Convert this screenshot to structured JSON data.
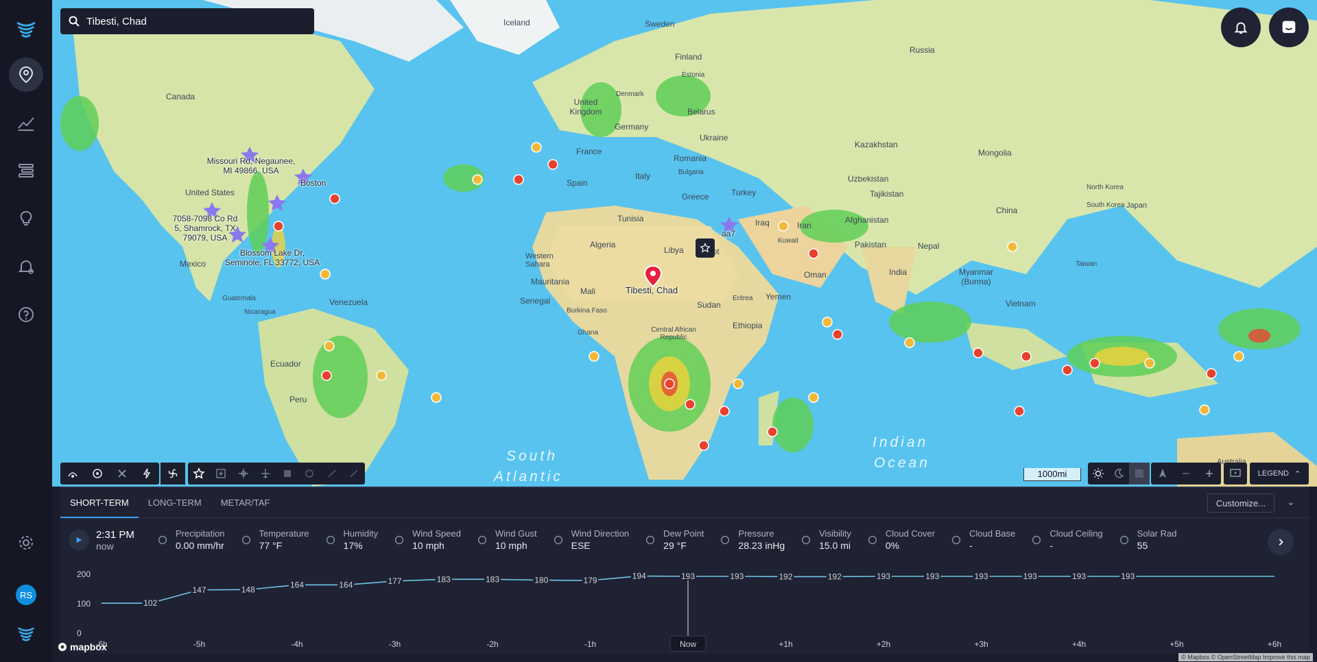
{
  "search": {
    "value": "Tibesti, Chad"
  },
  "map_labels": {
    "land": [
      {
        "text": "Iceland"
      },
      {
        "text": "Sweden"
      },
      {
        "text": "Finland"
      },
      {
        "text": "Russia"
      },
      {
        "text": "Estonia"
      },
      {
        "text": "Denmark"
      },
      {
        "text": "United Kingdom"
      },
      {
        "text": "Belarus"
      },
      {
        "text": "Germany"
      },
      {
        "text": "Ukraine"
      },
      {
        "text": "France"
      },
      {
        "text": "Romania"
      },
      {
        "text": "Bulgaria"
      },
      {
        "text": "Spain"
      },
      {
        "text": "Italy"
      },
      {
        "text": "Greece"
      },
      {
        "text": "Turkey"
      },
      {
        "text": "Kazakhstan"
      },
      {
        "text": "Mongolia"
      },
      {
        "text": "Uzbekistan"
      },
      {
        "text": "Tajikistan"
      },
      {
        "text": "Afghanistan"
      },
      {
        "text": "North Korea"
      },
      {
        "text": "South Korea"
      },
      {
        "text": "Japan"
      },
      {
        "text": "China"
      },
      {
        "text": "Iraq"
      },
      {
        "text": "Iran"
      },
      {
        "text": "Kuwait"
      },
      {
        "text": "Pakistan"
      },
      {
        "text": "Nepal"
      },
      {
        "text": "India"
      },
      {
        "text": "Oman"
      },
      {
        "text": "Yemen"
      },
      {
        "text": "Myanmar (Burma)"
      },
      {
        "text": "Taiwan"
      },
      {
        "text": "Vietnam"
      },
      {
        "text": "Tunisia"
      },
      {
        "text": "Algeria"
      },
      {
        "text": "Libya"
      },
      {
        "text": "Egypt"
      },
      {
        "text": "Western Sahara"
      },
      {
        "text": "Mauritania"
      },
      {
        "text": "Mali"
      },
      {
        "text": "Senegal"
      },
      {
        "text": "Burkina Faso"
      },
      {
        "text": "Sudan"
      },
      {
        "text": "Eritrea"
      },
      {
        "text": "Ethiopia"
      },
      {
        "text": "Ghana"
      },
      {
        "text": "Central African Republic"
      },
      {
        "text": "Canada"
      },
      {
        "text": "United States"
      },
      {
        "text": "Mexico"
      },
      {
        "text": "Guatemala"
      },
      {
        "text": "Nicaragua"
      },
      {
        "text": "Venezuela"
      },
      {
        "text": "Ecuador"
      },
      {
        "text": "Peru"
      },
      {
        "text": "Boston"
      },
      {
        "text": "Australia"
      }
    ],
    "seas": [
      {
        "text": "South"
      },
      {
        "text": "Atlantic"
      },
      {
        "text": "Indian"
      },
      {
        "text": "Ocean"
      }
    ],
    "saved": [
      {
        "text": "Missouri Rd, Negaunee, MI 49866, USA"
      },
      {
        "text": "7058-7098 Co Rd 5, Shamrock, TX 79079, USA"
      },
      {
        "text": "Blossom Lake Dr, Seminole, FL 33772, USA"
      },
      {
        "text": "aa7"
      }
    ]
  },
  "pin": {
    "label": "Tibesti, Chad"
  },
  "scale_label": "1000mi",
  "legend_label": "LEGEND",
  "tabs": [
    {
      "label": "SHORT-TERM"
    },
    {
      "label": "LONG-TERM"
    },
    {
      "label": "METAR/TAF"
    }
  ],
  "customize_label": "Customize...",
  "current": {
    "time": "2:31 PM",
    "sub": "now"
  },
  "metrics": [
    {
      "label": "Precipitation",
      "value": "0.00 mm/hr",
      "icon": "precipitation-icon"
    },
    {
      "label": "Temperature",
      "value": "77 °F",
      "icon": "thermometer-icon"
    },
    {
      "label": "Humidity",
      "value": "17%",
      "icon": "humidity-icon"
    },
    {
      "label": "Wind Speed",
      "value": "10 mph",
      "icon": "wind-icon"
    },
    {
      "label": "Wind Gust",
      "value": "10 mph",
      "icon": "wind-gust-icon"
    },
    {
      "label": "Wind Direction",
      "value": "ESE",
      "icon": "wind-direction-icon"
    },
    {
      "label": "Dew Point",
      "value": "29 °F",
      "icon": "dew-point-icon"
    },
    {
      "label": "Pressure",
      "value": "28.23 inHg",
      "icon": "pressure-icon"
    },
    {
      "label": "Visibility",
      "value": "15.0 mi",
      "icon": "eye-icon"
    },
    {
      "label": "Cloud Cover",
      "value": "0%",
      "icon": "cloud-icon"
    },
    {
      "label": "Cloud Base",
      "value": "-",
      "icon": "cloud-base-icon"
    },
    {
      "label": "Cloud Ceiling",
      "value": "-",
      "icon": "cloud-ceiling-icon"
    },
    {
      "label": "Solar Rad",
      "value": "55",
      "icon": "sun-icon"
    }
  ],
  "chart_data": {
    "type": "line",
    "ylim": [
      0,
      200
    ],
    "yticks": [
      "200",
      "100",
      "0"
    ],
    "xticks": [
      "-6h",
      "-5h",
      "-4h",
      "-3h",
      "-2h",
      "-1h",
      "Now",
      "+1h",
      "+2h",
      "+3h",
      "+4h",
      "+5h",
      "+6h"
    ],
    "x": [
      -6,
      -5.5,
      -5,
      -4.5,
      -4,
      -3.5,
      -3,
      -2.5,
      -2,
      -1.5,
      -1,
      -0.5,
      0,
      0.5,
      1,
      1.5,
      2,
      2.5,
      3,
      3.5,
      4,
      4.5,
      5,
      5.5,
      6
    ],
    "values": [
      102,
      147,
      148,
      164,
      164,
      177,
      183,
      183,
      180,
      179,
      194,
      193,
      193,
      192,
      192,
      193,
      193,
      193,
      193,
      193,
      193
    ],
    "labels": [
      "102",
      "147",
      "148",
      "164",
      "164",
      "177",
      "183",
      "183",
      "180",
      "179",
      "194",
      "193",
      "193",
      "192",
      "192",
      "193",
      "193",
      "193",
      "193",
      "193",
      "193"
    ],
    "label_x": [
      -5.5,
      -5,
      -4.5,
      -4,
      -3.5,
      -3,
      -2.5,
      -2,
      -1.5,
      -1,
      -0.5,
      0,
      0.5,
      1,
      1.5,
      2,
      2.5,
      3,
      3.5,
      4,
      4.5
    ],
    "now_label": "Now",
    "color": "#6fc6e8"
  },
  "mapbox": {
    "logo": "mapbox",
    "attribution": "© Mapbox © OpenStreetMap  Improve this map"
  },
  "avatar": {
    "initials": "RS"
  }
}
